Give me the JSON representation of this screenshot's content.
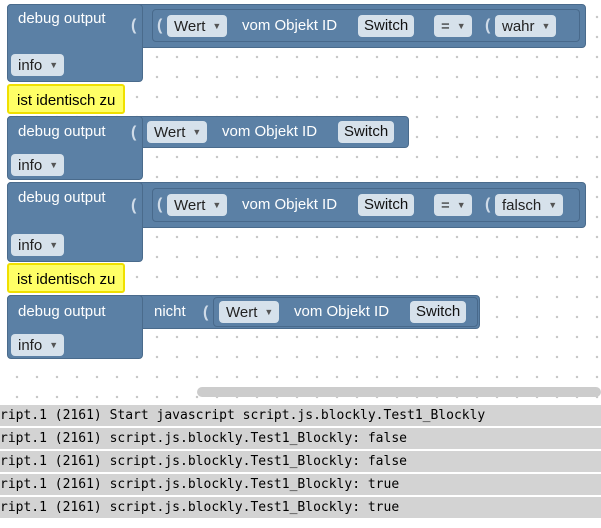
{
  "blocks": [
    {
      "title": "debug output",
      "level": "info",
      "expr": {
        "left": {
          "prop": "Wert",
          "mid": "vom Objekt ID",
          "id": "Switch"
        },
        "op": "=",
        "right": "wahr"
      }
    },
    {
      "highlight": "ist identisch zu"
    },
    {
      "title": "debug output",
      "level": "info",
      "expr": {
        "left": {
          "prop": "Wert",
          "mid": "vom Objekt ID",
          "id": "Switch"
        }
      }
    },
    {
      "title": "debug output",
      "level": "info",
      "expr": {
        "left": {
          "prop": "Wert",
          "mid": "vom Objekt ID",
          "id": "Switch"
        },
        "op": "=",
        "right": "falsch"
      }
    },
    {
      "highlight": "ist identisch zu"
    },
    {
      "title": "debug output",
      "level": "info",
      "expr": {
        "not": "nicht",
        "left": {
          "prop": "Wert",
          "mid": "vom Objekt ID",
          "id": "Switch"
        }
      }
    }
  ],
  "log": [
    "ript.1 (2161) Start javascript script.js.blockly.Test1_Blockly",
    "ript.1 (2161) script.js.blockly.Test1_Blockly: false",
    "ript.1 (2161) script.js.blockly.Test1_Blockly: false",
    "ript.1 (2161) script.js.blockly.Test1_Blockly: true",
    "ript.1 (2161) script.js.blockly.Test1_Blockly: true"
  ]
}
